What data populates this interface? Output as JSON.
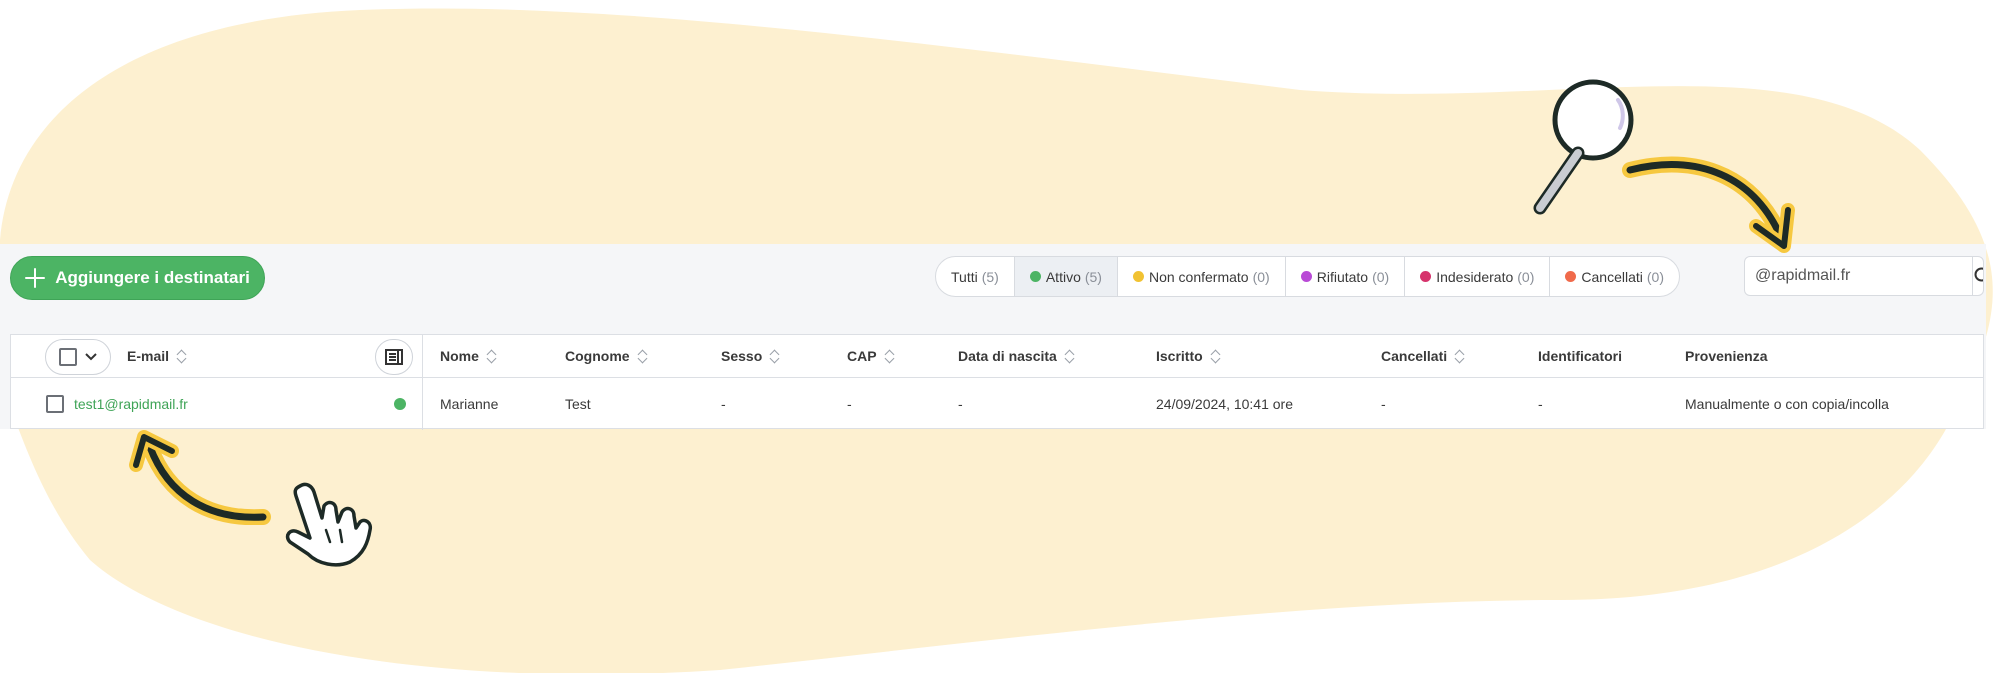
{
  "colors": {
    "blob": "#fdf0d0",
    "accent_green": "#4cb464",
    "arrow_yellow": "#f6c840",
    "status": {
      "attivo": "#4cb464",
      "non_confermato": "#f1c232",
      "rifiutato": "#b94ad6",
      "indesiderato": "#d6336c",
      "cancellati": "#f06a4b"
    }
  },
  "toolbar": {
    "add_button_label": "Aggiungere i destinatari",
    "add_icon": "plus-icon"
  },
  "filters": [
    {
      "label": "Tutti",
      "count": "(5)",
      "dot": null
    },
    {
      "label": "Attivo",
      "count": "(5)",
      "dot": "#4cb464",
      "active": true
    },
    {
      "label": "Non confermato",
      "count": "(0)",
      "dot": "#f1c232"
    },
    {
      "label": "Rifiutato",
      "count": "(0)",
      "dot": "#b94ad6"
    },
    {
      "label": "Indesiderato",
      "count": "(0)",
      "dot": "#d6336c"
    },
    {
      "label": "Cancellati",
      "count": "(0)",
      "dot": "#f06a4b"
    }
  ],
  "search": {
    "value": "@rapidmail.fr",
    "icon": "search-icon"
  },
  "table": {
    "columns": [
      "E-mail",
      "Nome",
      "Cognome",
      "Sesso",
      "CAP",
      "Data di nascita",
      "Iscritto",
      "Cancellati",
      "Identificatori",
      "Provenienza"
    ],
    "rows": [
      {
        "email": "test1@rapidmail.fr",
        "nome": "Marianne",
        "cognome": "Test",
        "sesso": "-",
        "cap": "-",
        "data_nascita": "-",
        "iscritto": "24/09/2024, 10:41 ore",
        "cancellati": "-",
        "identificatori": "-",
        "provenienza": "Manualmente o con copia/incolla"
      }
    ]
  }
}
